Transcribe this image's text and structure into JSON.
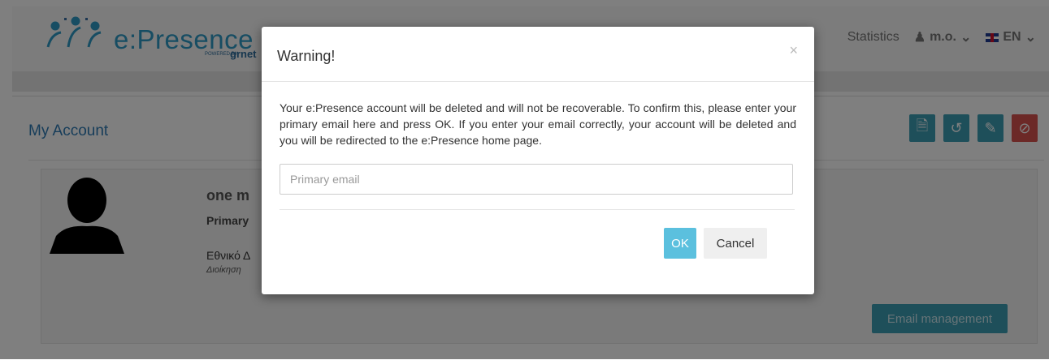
{
  "navbar": {
    "logo_text": "e:Presence",
    "logo_sub": "POWERED BY",
    "logo_grnet": "grnet",
    "statistics": "Statistics",
    "user": "m.o.",
    "language": "EN"
  },
  "account": {
    "title": "My Account",
    "name": "one m",
    "primary_label": "Primary",
    "org": "Εθνικό Δ",
    "org_sub": "Διοίκηση",
    "email_management": "Email management"
  },
  "icons": {
    "file": "file-icon",
    "history": "history-icon",
    "edit": "pencil-icon",
    "ban": "ban-icon",
    "user": "user-icon",
    "chevron": "chevron-down-icon",
    "flag": "uk-flag-icon"
  },
  "colors": {
    "accent": "#3d9fb5",
    "danger": "#d9534f",
    "ok": "#5bc0de"
  },
  "modal": {
    "title": "Warning!",
    "close": "×",
    "message": "Your e:Presence account will be deleted and will not be recoverable. To confirm this, please enter your primary email here and press OK. If you enter your email correctly, your account will be deleted and you will be redirected to the e:Presence home page.",
    "email_placeholder": "Primary email",
    "email_value": "",
    "ok_label": "OK",
    "cancel_label": "Cancel"
  }
}
